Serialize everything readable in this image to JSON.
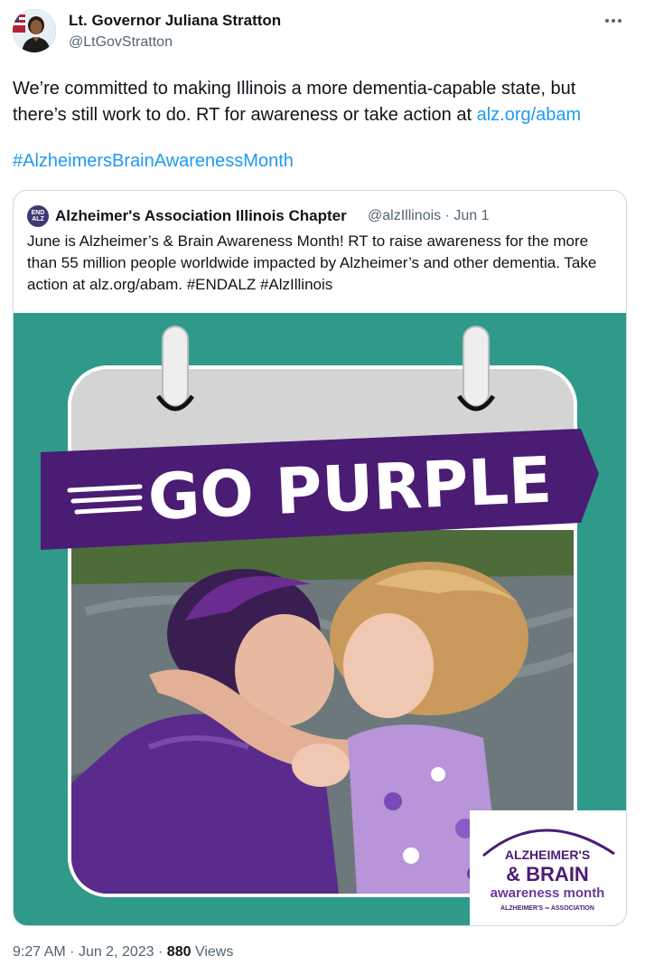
{
  "tweet": {
    "author_name": "Lt. Governor Juliana Stratton",
    "author_handle": "@LtGovStratton",
    "text_before_link": "We’re committed to making Illinois a more dementia-capable state, but there’s still work to do. RT for awareness or take action at ",
    "text_link": "alz.org/abam",
    "hashtag": "#AlzheimersBrainAwarenessMonth"
  },
  "quote": {
    "avatar_text_line1": "END",
    "avatar_text_line2": "ALZ",
    "author_name": "Alzheimer's Association Illinois Chapter",
    "author_handle": "@alzIllinois",
    "separator": "·",
    "date": "Jun 1",
    "text": "June is Alzheimer’s & Brain Awareness Month! RT to raise awareness for the more than 55 million people worldwide impacted by Alzheimer’s and other dementia. Take action at alz.org/abam. #ENDALZ #AlzIllinois"
  },
  "image": {
    "banner_text": "GO PURPLE",
    "logo_line1": "ALZHEIMER'S",
    "logo_line2": "& BRAIN",
    "logo_line3": "awareness month",
    "logo_line4": "ALZHEIMER'S ∞ ASSOCIATION"
  },
  "footer": {
    "time": "9:27 AM",
    "separator1": "·",
    "date": "Jun 2, 2023",
    "separator2": "·",
    "views_count": "880",
    "views_label": "Views"
  },
  "colors": {
    "link": "#1d9bf0",
    "teal": "#2f9a8a",
    "purple": "#4b1c74",
    "secondary_text": "#536471"
  }
}
